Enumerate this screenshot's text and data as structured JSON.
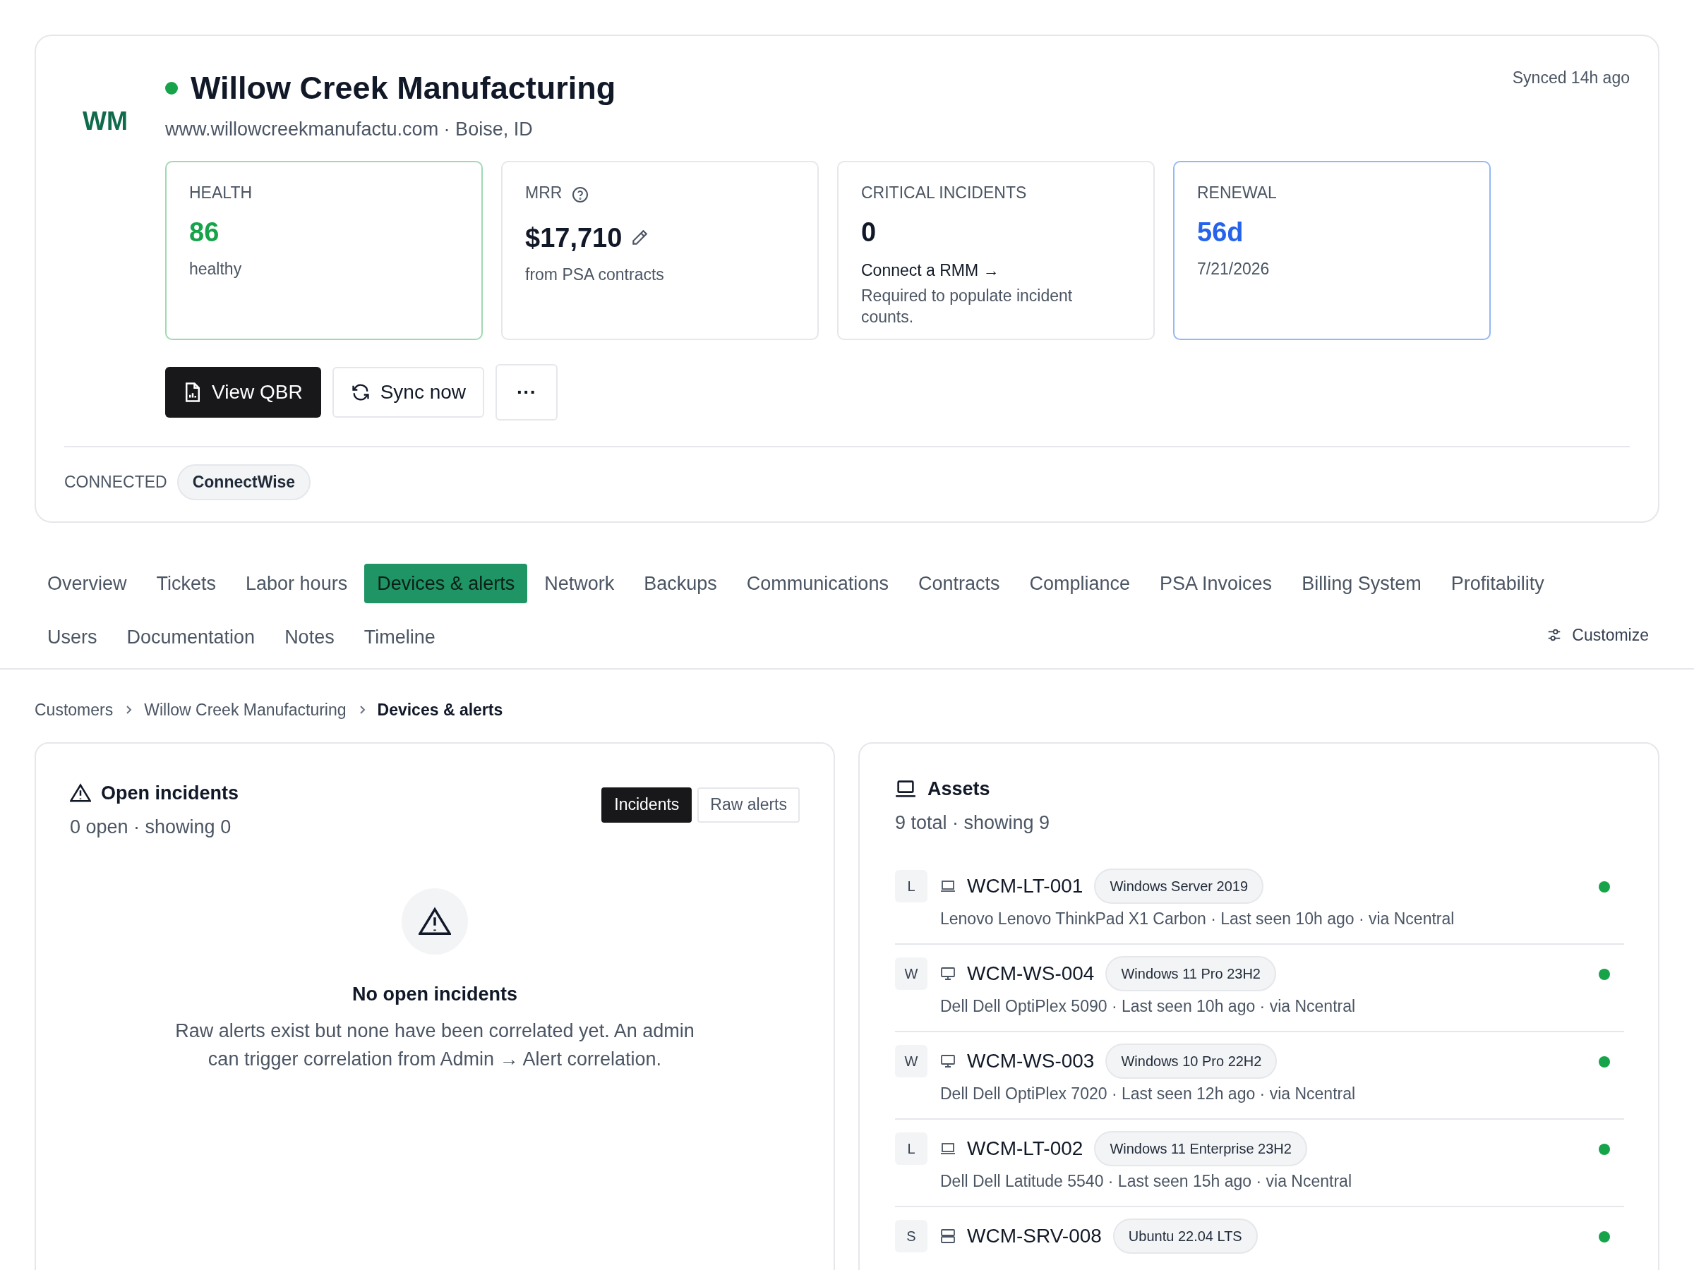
{
  "customer": {
    "initials": "WM",
    "name": "Willow Creek Manufacturing",
    "online": true,
    "subtitle": "www.willowcreekmanufactu.com · Boise, ID",
    "synced": "Synced 14h ago"
  },
  "metrics": [
    {
      "kind": "health",
      "label": "HEALTH",
      "value": "86",
      "note": "healthy"
    },
    {
      "kind": "mrr",
      "label": "MRR",
      "value": "$17,710",
      "note": "from PSA contracts"
    },
    {
      "kind": "incidents",
      "label": "CRITICAL INCIDENTS",
      "value": "0",
      "link": "Connect a RMM →",
      "note": "Required to populate incident counts."
    },
    {
      "kind": "renewal",
      "label": "RENEWAL",
      "value": "56d",
      "note": "7/21/2026"
    }
  ],
  "actions": [
    {
      "kind": "primary",
      "label": "View QBR"
    },
    {
      "kind": "sync",
      "label": "Sync now"
    },
    {
      "kind": "more",
      "label": "···"
    }
  ],
  "connected": {
    "label": "CONNECTED",
    "integrations": [
      "ConnectWise"
    ]
  },
  "tabs": [
    {
      "label": "Overview",
      "selected": false
    },
    {
      "label": "Tickets",
      "selected": false
    },
    {
      "label": "Labor hours",
      "selected": false
    },
    {
      "label": "Devices & alerts",
      "selected": true
    },
    {
      "label": "Network",
      "selected": false
    },
    {
      "label": "Backups",
      "selected": false
    },
    {
      "label": "Communications",
      "selected": false
    },
    {
      "label": "Contracts",
      "selected": false
    },
    {
      "label": "Compliance",
      "selected": false
    },
    {
      "label": "PSA Invoices",
      "selected": false
    },
    {
      "label": "Billing System",
      "selected": false
    },
    {
      "label": "Profitability",
      "selected": false
    },
    {
      "label": "Users",
      "selected": false
    },
    {
      "label": "Documentation",
      "selected": false
    },
    {
      "label": "Notes",
      "selected": false
    },
    {
      "label": "Timeline",
      "selected": false
    }
  ],
  "customize": "Customize",
  "breadcrumb": [
    "Customers",
    "Willow Creek Manufacturing",
    "Devices & alerts"
  ],
  "incidents_panel": {
    "title": "Open incidents",
    "subtitle": "0 open · showing 0",
    "toggle": [
      {
        "label": "Incidents",
        "selected": true
      },
      {
        "label": "Raw alerts",
        "selected": false
      }
    ],
    "empty_title": "No open incidents",
    "empty_text": "Raw alerts exist but none have been correlated yet. An admin can trigger correlation from Admin → Alert correlation."
  },
  "assets_panel": {
    "title": "Assets",
    "subtitle": "9 total · showing 9",
    "rows": [
      {
        "kind": "laptop",
        "letter": "L",
        "name": "WCM-LT-001",
        "os": "Windows Server 2019",
        "detail": "Lenovo Lenovo ThinkPad X1 Carbon · Last seen 10h ago · via Ncentral",
        "online": true
      },
      {
        "kind": "desktop",
        "letter": "W",
        "name": "WCM-WS-004",
        "os": "Windows 11 Pro 23H2",
        "detail": "Dell Dell OptiPlex 5090 · Last seen 10h ago · via Ncentral",
        "online": true
      },
      {
        "kind": "desktop",
        "letter": "W",
        "name": "WCM-WS-003",
        "os": "Windows 10 Pro 22H2",
        "detail": "Dell Dell OptiPlex 7020 · Last seen 12h ago · via Ncentral",
        "online": true
      },
      {
        "kind": "laptop",
        "letter": "L",
        "name": "WCM-LT-002",
        "os": "Windows 11 Enterprise 23H2",
        "detail": "Dell Dell Latitude 5540 · Last seen 15h ago · via Ncentral",
        "online": true
      },
      {
        "kind": "server",
        "letter": "S",
        "name": "WCM-SRV-008",
        "os": "Ubuntu 22.04 LTS",
        "online": true
      }
    ]
  }
}
